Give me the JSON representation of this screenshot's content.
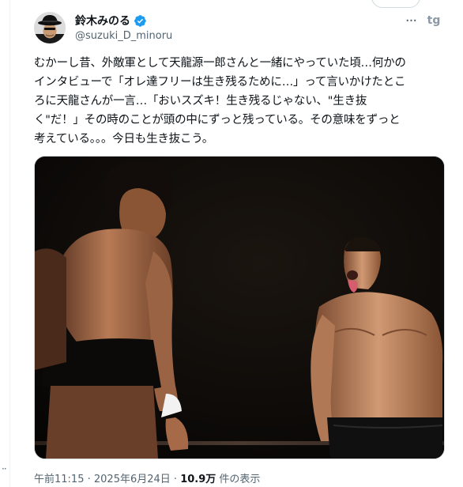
{
  "author": {
    "display_name": "鈴木みのる",
    "handle": "@suzuki_D_minoru",
    "verified": true,
    "avatar_icon": "avatar-man-black-hat"
  },
  "header": {
    "more_icon": "more-dots-icon",
    "more_label": "···",
    "grok_icon": "grok-icon",
    "grok_label": "tg"
  },
  "tweet": {
    "lines": [
      "むかーし昔、外敵軍として天龍源一郎さんと一緒にやっていた頃…何かの",
      "インタビューで「オレ達フリーは生き残るために…」って言いかけたとこ",
      "ろに天龍さんが一言…「おいスズキ！生き残るじゃない、\"生き抜",
      "く\"だ！」その時のことが頭の中にずっと残っている。その意味をずっと",
      "考えている。。。今日も生き抜こう。"
    ]
  },
  "media": {
    "type": "photo",
    "subject": "two-wrestlers-in-ring"
  },
  "footer": {
    "time": "午前11:15",
    "separator": " · ",
    "date": "2025年6月24日",
    "views_count": "10.9万",
    "views_label": " 件の表示"
  },
  "left_rail": {
    "dots": "··"
  },
  "colors": {
    "text": "#0f1419",
    "secondary": "#536471",
    "verified": "#1d9bf0",
    "border": "#cfd9de"
  }
}
